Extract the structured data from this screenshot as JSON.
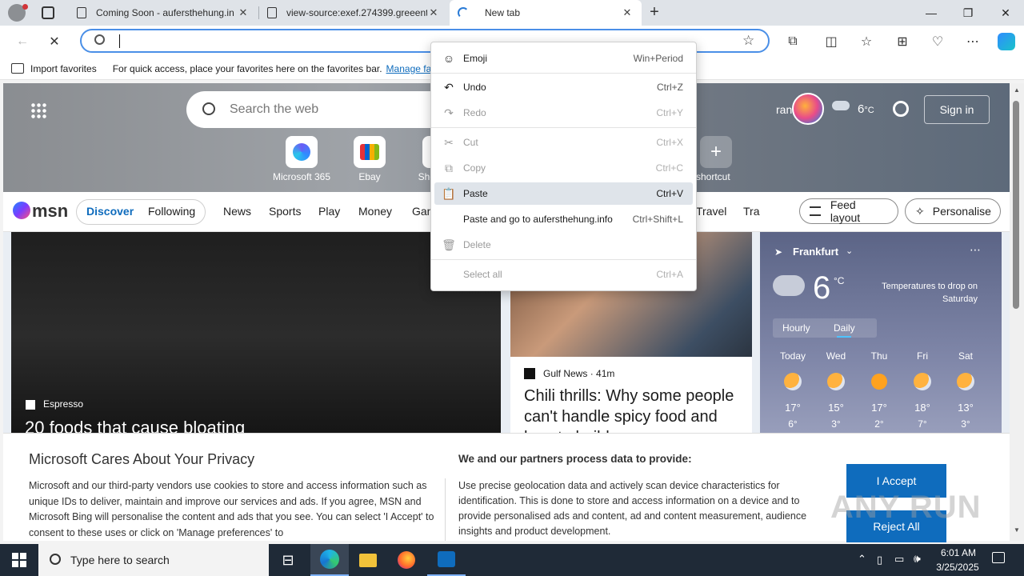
{
  "tabs": [
    {
      "title": "Coming Soon - aufersthehung.in",
      "close": "✕"
    },
    {
      "title": "view-source:exef.274399.greeent",
      "close": "✕"
    },
    {
      "title": "New tab",
      "close": "✕"
    }
  ],
  "window": {
    "minimize": "—",
    "maximize": "❐",
    "close": "✕"
  },
  "favorites_bar": {
    "import_label": "Import favorites",
    "hint": "For quick access, place your favorites here on the favorites bar.",
    "manage_link": "Manage fav"
  },
  "newtab": {
    "search_placeholder": "Search the web",
    "location_partial": "rankfur",
    "temperature": "6",
    "temp_unit": "°C",
    "sign_in": "Sign in",
    "shortcuts": [
      {
        "label": "Microsoft 365"
      },
      {
        "label": "Ebay"
      },
      {
        "label": "Sho"
      },
      {
        "label": "d shortcut"
      }
    ]
  },
  "msn": {
    "logo": "msn",
    "tabs": [
      "Discover",
      "Following"
    ],
    "nav": [
      "News",
      "Sports",
      "Play",
      "Money",
      "Gan",
      "Travel",
      "Tra"
    ],
    "feed_layout": "Feed layout",
    "personalise": "Personalise"
  },
  "lead_card": {
    "source": "Espresso",
    "headline": "20 foods that cause bloating"
  },
  "news_card": {
    "source": "Gulf News",
    "time": "41m",
    "headline": "Chili thrills: Why some people can't handle spicy food and how to build"
  },
  "weather": {
    "city": "Frankfurt",
    "temp": "6",
    "unit": "°C",
    "note": "Temperatures to drop on Saturday",
    "toggle": [
      "Hourly",
      "Daily"
    ],
    "days": [
      {
        "d": "Today",
        "hi": "17°",
        "lo": "6°"
      },
      {
        "d": "Wed",
        "hi": "15°",
        "lo": "3°"
      },
      {
        "d": "Thu",
        "hi": "17°",
        "lo": "2°"
      },
      {
        "d": "Fri",
        "hi": "18°",
        "lo": "7°"
      },
      {
        "d": "Sat",
        "hi": "13°",
        "lo": "3°"
      }
    ]
  },
  "context_menu": {
    "emoji": {
      "label": "Emoji",
      "shortcut": "Win+Period"
    },
    "undo": {
      "label": "Undo",
      "shortcut": "Ctrl+Z"
    },
    "redo": {
      "label": "Redo",
      "shortcut": "Ctrl+Y"
    },
    "cut": {
      "label": "Cut",
      "shortcut": "Ctrl+X"
    },
    "copy": {
      "label": "Copy",
      "shortcut": "Ctrl+C"
    },
    "paste": {
      "label": "Paste",
      "shortcut": "Ctrl+V"
    },
    "paste_go": {
      "label": "Paste and go to aufersthehung.info",
      "shortcut": "Ctrl+Shift+L"
    },
    "delete": {
      "label": "Delete",
      "shortcut": ""
    },
    "select_all": {
      "label": "Select all",
      "shortcut": "Ctrl+A"
    }
  },
  "privacy": {
    "title": "Microsoft Cares About Your Privacy",
    "body": "Microsoft and our third-party vendors use cookies to store and access information such as unique IDs to deliver, maintain and improve our services and ads. If you agree, MSN and Microsoft Bing will personalise the content and ads that you see. You can select 'I Accept' to consent to these uses or click on 'Manage preferences' to",
    "partners_title": "We and our partners process data to provide:",
    "partners_body": "Use precise geolocation data and actively scan device characteristics for identification. This is done to store and access information on a device and to provide personalised ads and content, ad and content measurement, audience insights and product development.",
    "accept": "I Accept",
    "reject": "Reject All"
  },
  "watermark": "ANY RUN",
  "taskbar": {
    "search_placeholder": "Type here to search",
    "time": "6:01 AM",
    "date": "3/25/2025"
  },
  "colors": {
    "accent": "#0f6cbd",
    "tab_strip": "#dfe3e8",
    "taskbar": "#1f2a37"
  }
}
